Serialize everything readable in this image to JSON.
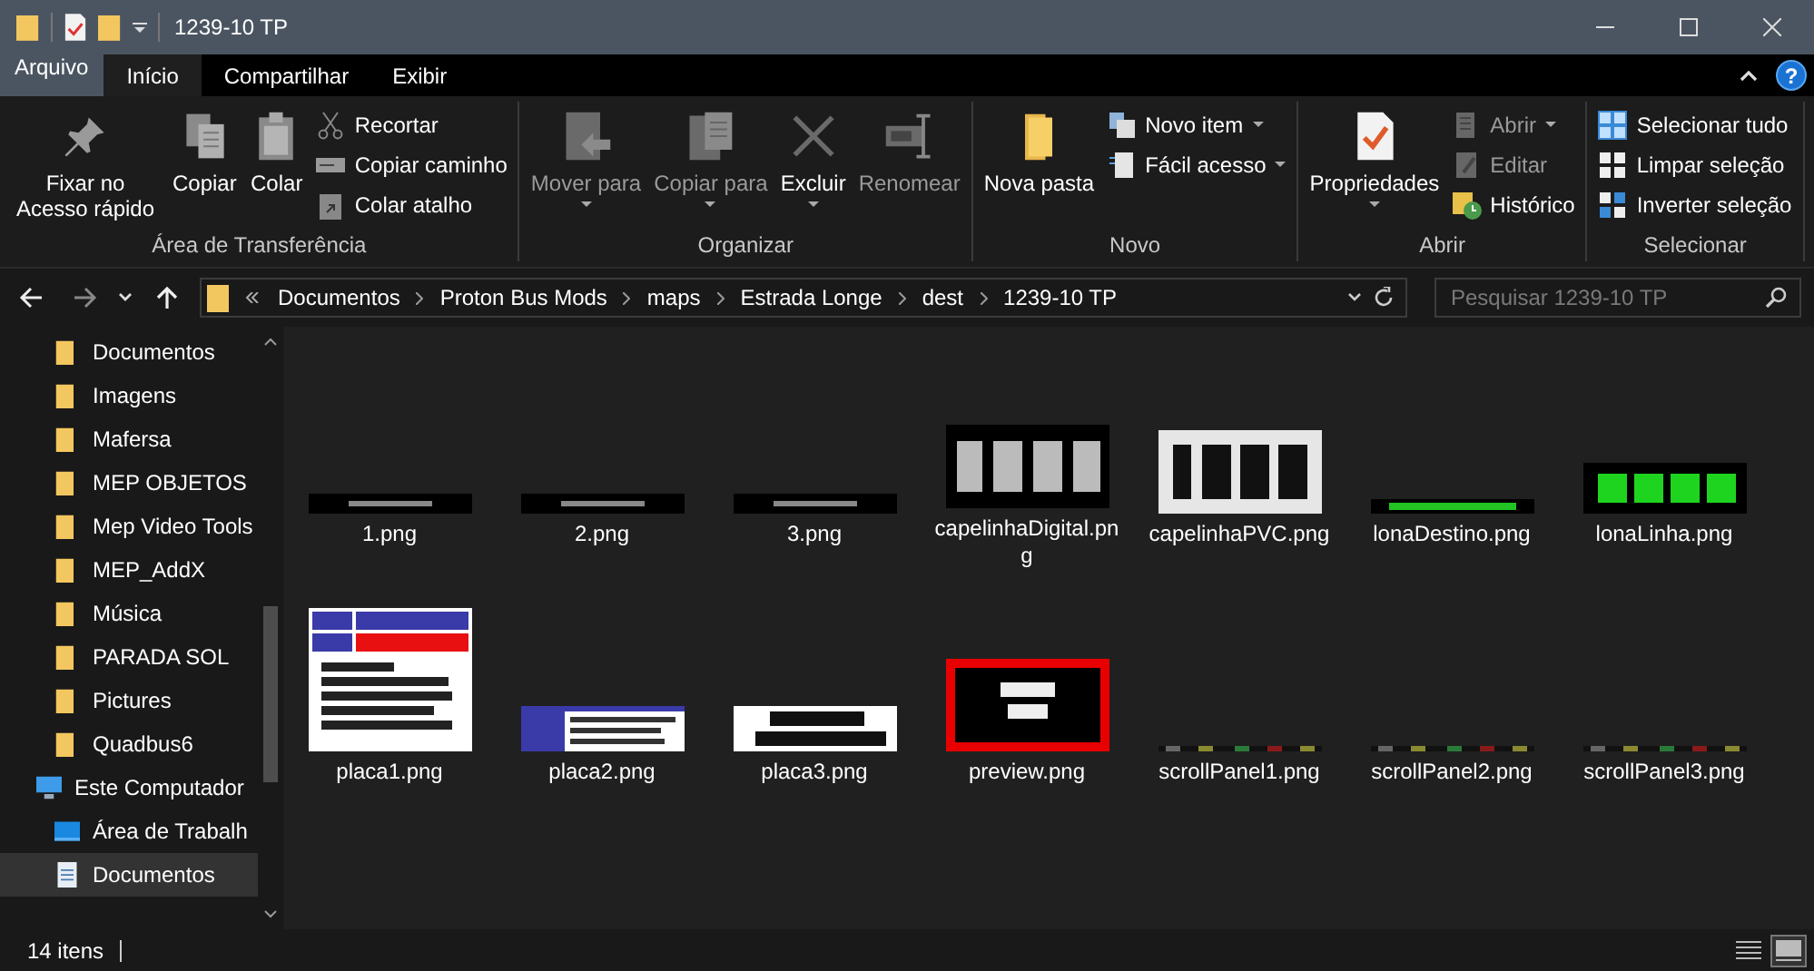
{
  "window": {
    "title": "1239-10 TP",
    "controls": [
      {
        "kind": "minimize"
      },
      {
        "kind": "maximize"
      },
      {
        "kind": "close"
      }
    ]
  },
  "ribbon_tabs": [
    {
      "label": "Arquivo",
      "kind": "file-menu",
      "selected": false
    },
    {
      "label": "Início",
      "kind": "tab",
      "selected": true
    },
    {
      "label": "Compartilhar",
      "kind": "tab",
      "selected": false
    },
    {
      "label": "Exibir",
      "kind": "tab",
      "selected": false
    }
  ],
  "help_label": "?",
  "ribbon_groups": [
    {
      "label": "Área de Transferência",
      "commands": [
        {
          "label": "Fixar no Acesso rápido",
          "kind": "large",
          "disabled": false,
          "dropdown": false
        },
        {
          "label": "Copiar",
          "kind": "large",
          "disabled": false,
          "dropdown": false
        },
        {
          "label": "Colar",
          "kind": "large",
          "disabled": false,
          "dropdown": false
        },
        {
          "label": "Recortar",
          "kind": "small",
          "disabled": false,
          "dropdown": false
        },
        {
          "label": "Copiar caminho",
          "kind": "small",
          "disabled": false,
          "dropdown": false
        },
        {
          "label": "Colar atalho",
          "kind": "small",
          "disabled": false,
          "dropdown": false
        }
      ]
    },
    {
      "label": "Organizar",
      "commands": [
        {
          "label": "Mover para",
          "kind": "large",
          "disabled": true,
          "dropdown": true
        },
        {
          "label": "Copiar para",
          "kind": "large",
          "disabled": true,
          "dropdown": true
        },
        {
          "label": "Excluir",
          "kind": "large",
          "disabled": false,
          "dropdown": true
        },
        {
          "label": "Renomear",
          "kind": "large",
          "disabled": true,
          "dropdown": false
        }
      ]
    },
    {
      "label": "Novo",
      "commands": [
        {
          "label": "Nova pasta",
          "kind": "large",
          "disabled": false,
          "dropdown": false
        },
        {
          "label": "Novo item",
          "kind": "small",
          "disabled": false,
          "dropdown": true
        },
        {
          "label": "Fácil acesso",
          "kind": "small",
          "disabled": false,
          "dropdown": true
        }
      ]
    },
    {
      "label": "Abrir",
      "commands": [
        {
          "label": "Propriedades",
          "kind": "large",
          "disabled": false,
          "dropdown": true
        },
        {
          "label": "Abrir",
          "kind": "small",
          "disabled": true,
          "dropdown": true
        },
        {
          "label": "Editar",
          "kind": "small",
          "disabled": true,
          "dropdown": false
        },
        {
          "label": "Histórico",
          "kind": "small",
          "disabled": false,
          "dropdown": false
        }
      ]
    },
    {
      "label": "Selecionar",
      "commands": [
        {
          "label": "Selecionar tudo",
          "kind": "small",
          "disabled": false,
          "dropdown": false
        },
        {
          "label": "Limpar seleção",
          "kind": "small",
          "disabled": false,
          "dropdown": false
        },
        {
          "label": "Inverter seleção",
          "kind": "small",
          "disabled": false,
          "dropdown": false
        }
      ]
    }
  ],
  "address_bar": {
    "breadcrumbs": [
      "Documentos",
      "Proton Bus Mods",
      "maps",
      "Estrada Longe",
      "dest",
      "1239-10 TP"
    ]
  },
  "search": {
    "placeholder": "Pesquisar 1239-10 TP"
  },
  "sidebar": {
    "items": [
      {
        "label": "Documentos",
        "kind": "folder",
        "selected": false
      },
      {
        "label": "Imagens",
        "kind": "folder",
        "selected": false
      },
      {
        "label": "Mafersa",
        "kind": "folder",
        "selected": false
      },
      {
        "label": "MEP OBJETOS",
        "kind": "folder",
        "selected": false
      },
      {
        "label": "Mep Video Tools",
        "kind": "folder",
        "selected": false
      },
      {
        "label": "MEP_AddX",
        "kind": "folder",
        "selected": false
      },
      {
        "label": "Música",
        "kind": "folder",
        "selected": false
      },
      {
        "label": "PARADA SOL",
        "kind": "folder",
        "selected": false
      },
      {
        "label": "Pictures",
        "kind": "folder",
        "selected": false
      },
      {
        "label": "Quadbus6",
        "kind": "folder",
        "selected": false
      },
      {
        "label": "Este Computador",
        "kind": "computer",
        "selected": false,
        "children": [
          {
            "label": "Área de Trabalh",
            "kind": "desktop",
            "selected": false
          },
          {
            "label": "Documentos",
            "kind": "documents",
            "selected": true
          }
        ]
      }
    ]
  },
  "files": [
    {
      "name": "1.png",
      "kind": "picture"
    },
    {
      "name": "2.png",
      "kind": "picture"
    },
    {
      "name": "3.png",
      "kind": "picture"
    },
    {
      "name": "capelinhaDigital.png",
      "kind": "picture"
    },
    {
      "name": "capelinhaPVC.png",
      "kind": "picture"
    },
    {
      "name": "lonaDestino.png",
      "kind": "picture"
    },
    {
      "name": "lonaLinha.png",
      "kind": "picture"
    },
    {
      "name": "placa1.png",
      "kind": "picture"
    },
    {
      "name": "placa2.png",
      "kind": "picture"
    },
    {
      "name": "placa3.png",
      "kind": "picture"
    },
    {
      "name": "preview.png",
      "kind": "picture"
    },
    {
      "name": "scrollPanel1.png",
      "kind": "picture"
    },
    {
      "name": "scrollPanel2.png",
      "kind": "picture"
    },
    {
      "name": "scrollPanel3.png",
      "kind": "picture"
    }
  ],
  "status_bar": {
    "count": "14 itens",
    "views": [
      {
        "kind": "details",
        "selected": false
      },
      {
        "kind": "large-icons",
        "selected": true
      }
    ]
  }
}
